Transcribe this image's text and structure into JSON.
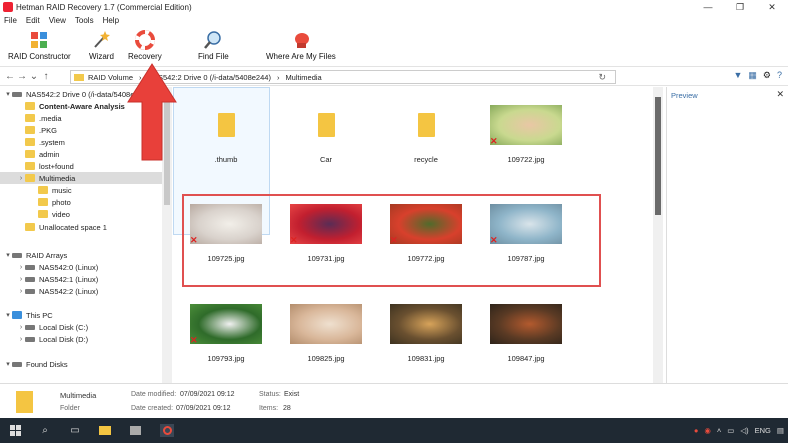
{
  "window": {
    "title": "Hetman RAID Recovery 1.7 (Commercial Edition)",
    "controls": [
      "—",
      "❐",
      "✕"
    ]
  },
  "menu": [
    "File",
    "Edit",
    "View",
    "Tools",
    "Help"
  ],
  "toolbar": {
    "raid_constructor": "RAID Constructor",
    "wizard": "Wizard",
    "recovery": "Recovery",
    "find_file": "Find File",
    "where_are_my_files": "Where Are My Files"
  },
  "address": {
    "segments": [
      "RAID Volume",
      "NAS542:2 Drive 0 (/i-data/5408e244)",
      "Multimedia"
    ],
    "refresh": "↻"
  },
  "tree": {
    "items": [
      {
        "label": "NAS542:2 Drive 0 (/i-data/5408e244)",
        "type": "drive",
        "indent": 0,
        "exp": "▾"
      },
      {
        "label": "Content-Aware Analysis",
        "type": "folder",
        "indent": 1,
        "exp": "",
        "bold": true
      },
      {
        "label": ".media",
        "type": "folder",
        "indent": 1,
        "exp": ""
      },
      {
        "label": ".PKG",
        "type": "folder",
        "indent": 1,
        "exp": ""
      },
      {
        "label": ".system",
        "type": "folder",
        "indent": 1,
        "exp": ""
      },
      {
        "label": "admin",
        "type": "folder",
        "indent": 1,
        "exp": ""
      },
      {
        "label": "lost+found",
        "type": "folder",
        "indent": 1,
        "exp": ""
      },
      {
        "label": "Multimedia",
        "type": "folder",
        "indent": 1,
        "exp": "›",
        "selected": true
      },
      {
        "label": "music",
        "type": "folder",
        "indent": 2,
        "exp": ""
      },
      {
        "label": "photo",
        "type": "folder",
        "indent": 2,
        "exp": ""
      },
      {
        "label": "video",
        "type": "folder",
        "indent": 2,
        "exp": ""
      },
      {
        "label": "Unallocated space 1",
        "type": "folder",
        "indent": 1,
        "exp": ""
      },
      {
        "label": "RAID Arrays",
        "type": "drive",
        "indent": 0,
        "exp": "▾"
      },
      {
        "label": "NAS542:0 (Linux)",
        "type": "drive",
        "indent": 1,
        "exp": "›"
      },
      {
        "label": "NAS542:1 (Linux)",
        "type": "drive",
        "indent": 1,
        "exp": "›"
      },
      {
        "label": "NAS542:2 (Linux)",
        "type": "drive",
        "indent": 1,
        "exp": "›"
      },
      {
        "label": "This PC",
        "type": "pc",
        "indent": 0,
        "exp": "▾"
      },
      {
        "label": "Local Disk (C:)",
        "type": "drive",
        "indent": 1,
        "exp": "›"
      },
      {
        "label": "Local Disk (D:)",
        "type": "drive",
        "indent": 1,
        "exp": "›"
      },
      {
        "label": "Found Disks",
        "type": "drive",
        "indent": 0,
        "exp": "▾"
      }
    ]
  },
  "files": [
    {
      "name": ".thumb",
      "kind": "folder"
    },
    {
      "name": "Car",
      "kind": "folder"
    },
    {
      "name": "recycle",
      "kind": "folder"
    },
    {
      "name": "109722.jpg",
      "kind": "photo",
      "deleted": true,
      "colors": [
        "#c9d98f",
        "#e9c7a5",
        "#86a95a"
      ]
    },
    {
      "name": "109725.jpg",
      "kind": "photo",
      "deleted": true,
      "colors": [
        "#d9d2cc",
        "#f2efe9",
        "#b7a9a0"
      ]
    },
    {
      "name": "109731.jpg",
      "kind": "photo",
      "deleted": true,
      "colors": [
        "#c21f2f",
        "#5a2c55",
        "#e84545"
      ]
    },
    {
      "name": "109772.jpg",
      "kind": "photo",
      "deleted": true,
      "colors": [
        "#d8402c",
        "#4f6b2b",
        "#a53a22"
      ]
    },
    {
      "name": "109787.jpg",
      "kind": "photo",
      "deleted": true,
      "colors": [
        "#8fb5c9",
        "#d9e4ea",
        "#6d8ea1"
      ]
    },
    {
      "name": "109793.jpg",
      "kind": "photo",
      "deleted": true,
      "colors": [
        "#2f6b2a",
        "#f1f1f1",
        "#4c8f3a"
      ]
    },
    {
      "name": "109825.jpg",
      "kind": "photo",
      "deleted": false,
      "colors": [
        "#d9b79a",
        "#efe0cf",
        "#b38d6c"
      ]
    },
    {
      "name": "109831.jpg",
      "kind": "photo",
      "deleted": false,
      "colors": [
        "#6a5030",
        "#d7a35a",
        "#3d3220"
      ]
    },
    {
      "name": "109847.jpg",
      "kind": "photo",
      "deleted": false,
      "colors": [
        "#5a3a24",
        "#b35a2e",
        "#2e241a"
      ]
    }
  ],
  "preview": {
    "title": "Preview",
    "close": "✕"
  },
  "status": {
    "name": "Multimedia",
    "type": "Folder",
    "modified_label": "Date modified:",
    "modified_value": "07/09/2021 09:12",
    "created_label": "Date created:",
    "created_value": "07/09/2021 09:12",
    "status_label": "Status:",
    "status_value": "Exist",
    "items_label": "Items:",
    "items_value": "28"
  },
  "taskbar": {
    "lang": "ENG"
  },
  "colors": {
    "accent": "#3a6ea5",
    "highlight": "#e05050",
    "folder": "#f4c542"
  }
}
